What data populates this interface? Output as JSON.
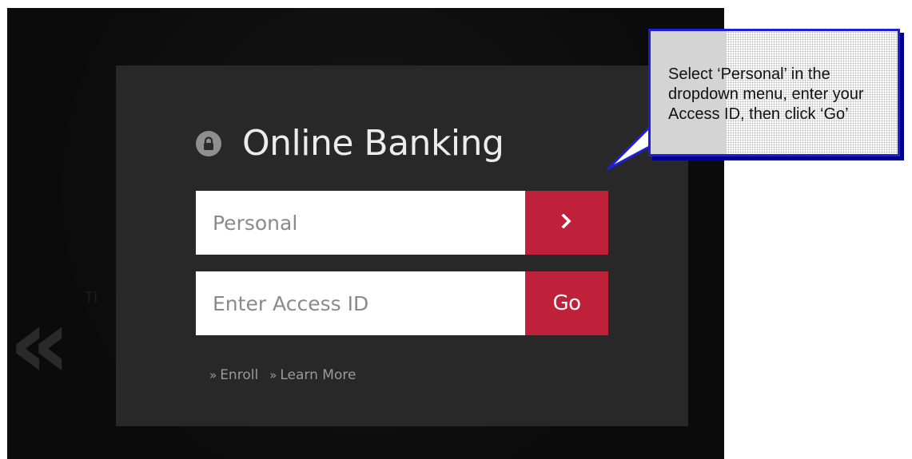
{
  "login": {
    "title": "Online Banking",
    "account_type": {
      "selected": "Personal",
      "submit_icon": "chevron-right-icon",
      "submit_glyph": "›"
    },
    "access_id": {
      "placeholder": "Enter Access ID",
      "value": "",
      "button_label": "Go"
    },
    "links": [
      {
        "label": "Enroll",
        "glyph": "»"
      },
      {
        "label": "Learn More",
        "glyph": "»"
      }
    ],
    "previous_glyph": "«"
  },
  "callout": {
    "text": "Select ‘Personal’ in the dropdown menu, enter your Access ID, then click ‘Go’"
  },
  "colors": {
    "accent_red": "#c0213a",
    "panel": "#282828",
    "callout_border": "#1f1fd6"
  }
}
